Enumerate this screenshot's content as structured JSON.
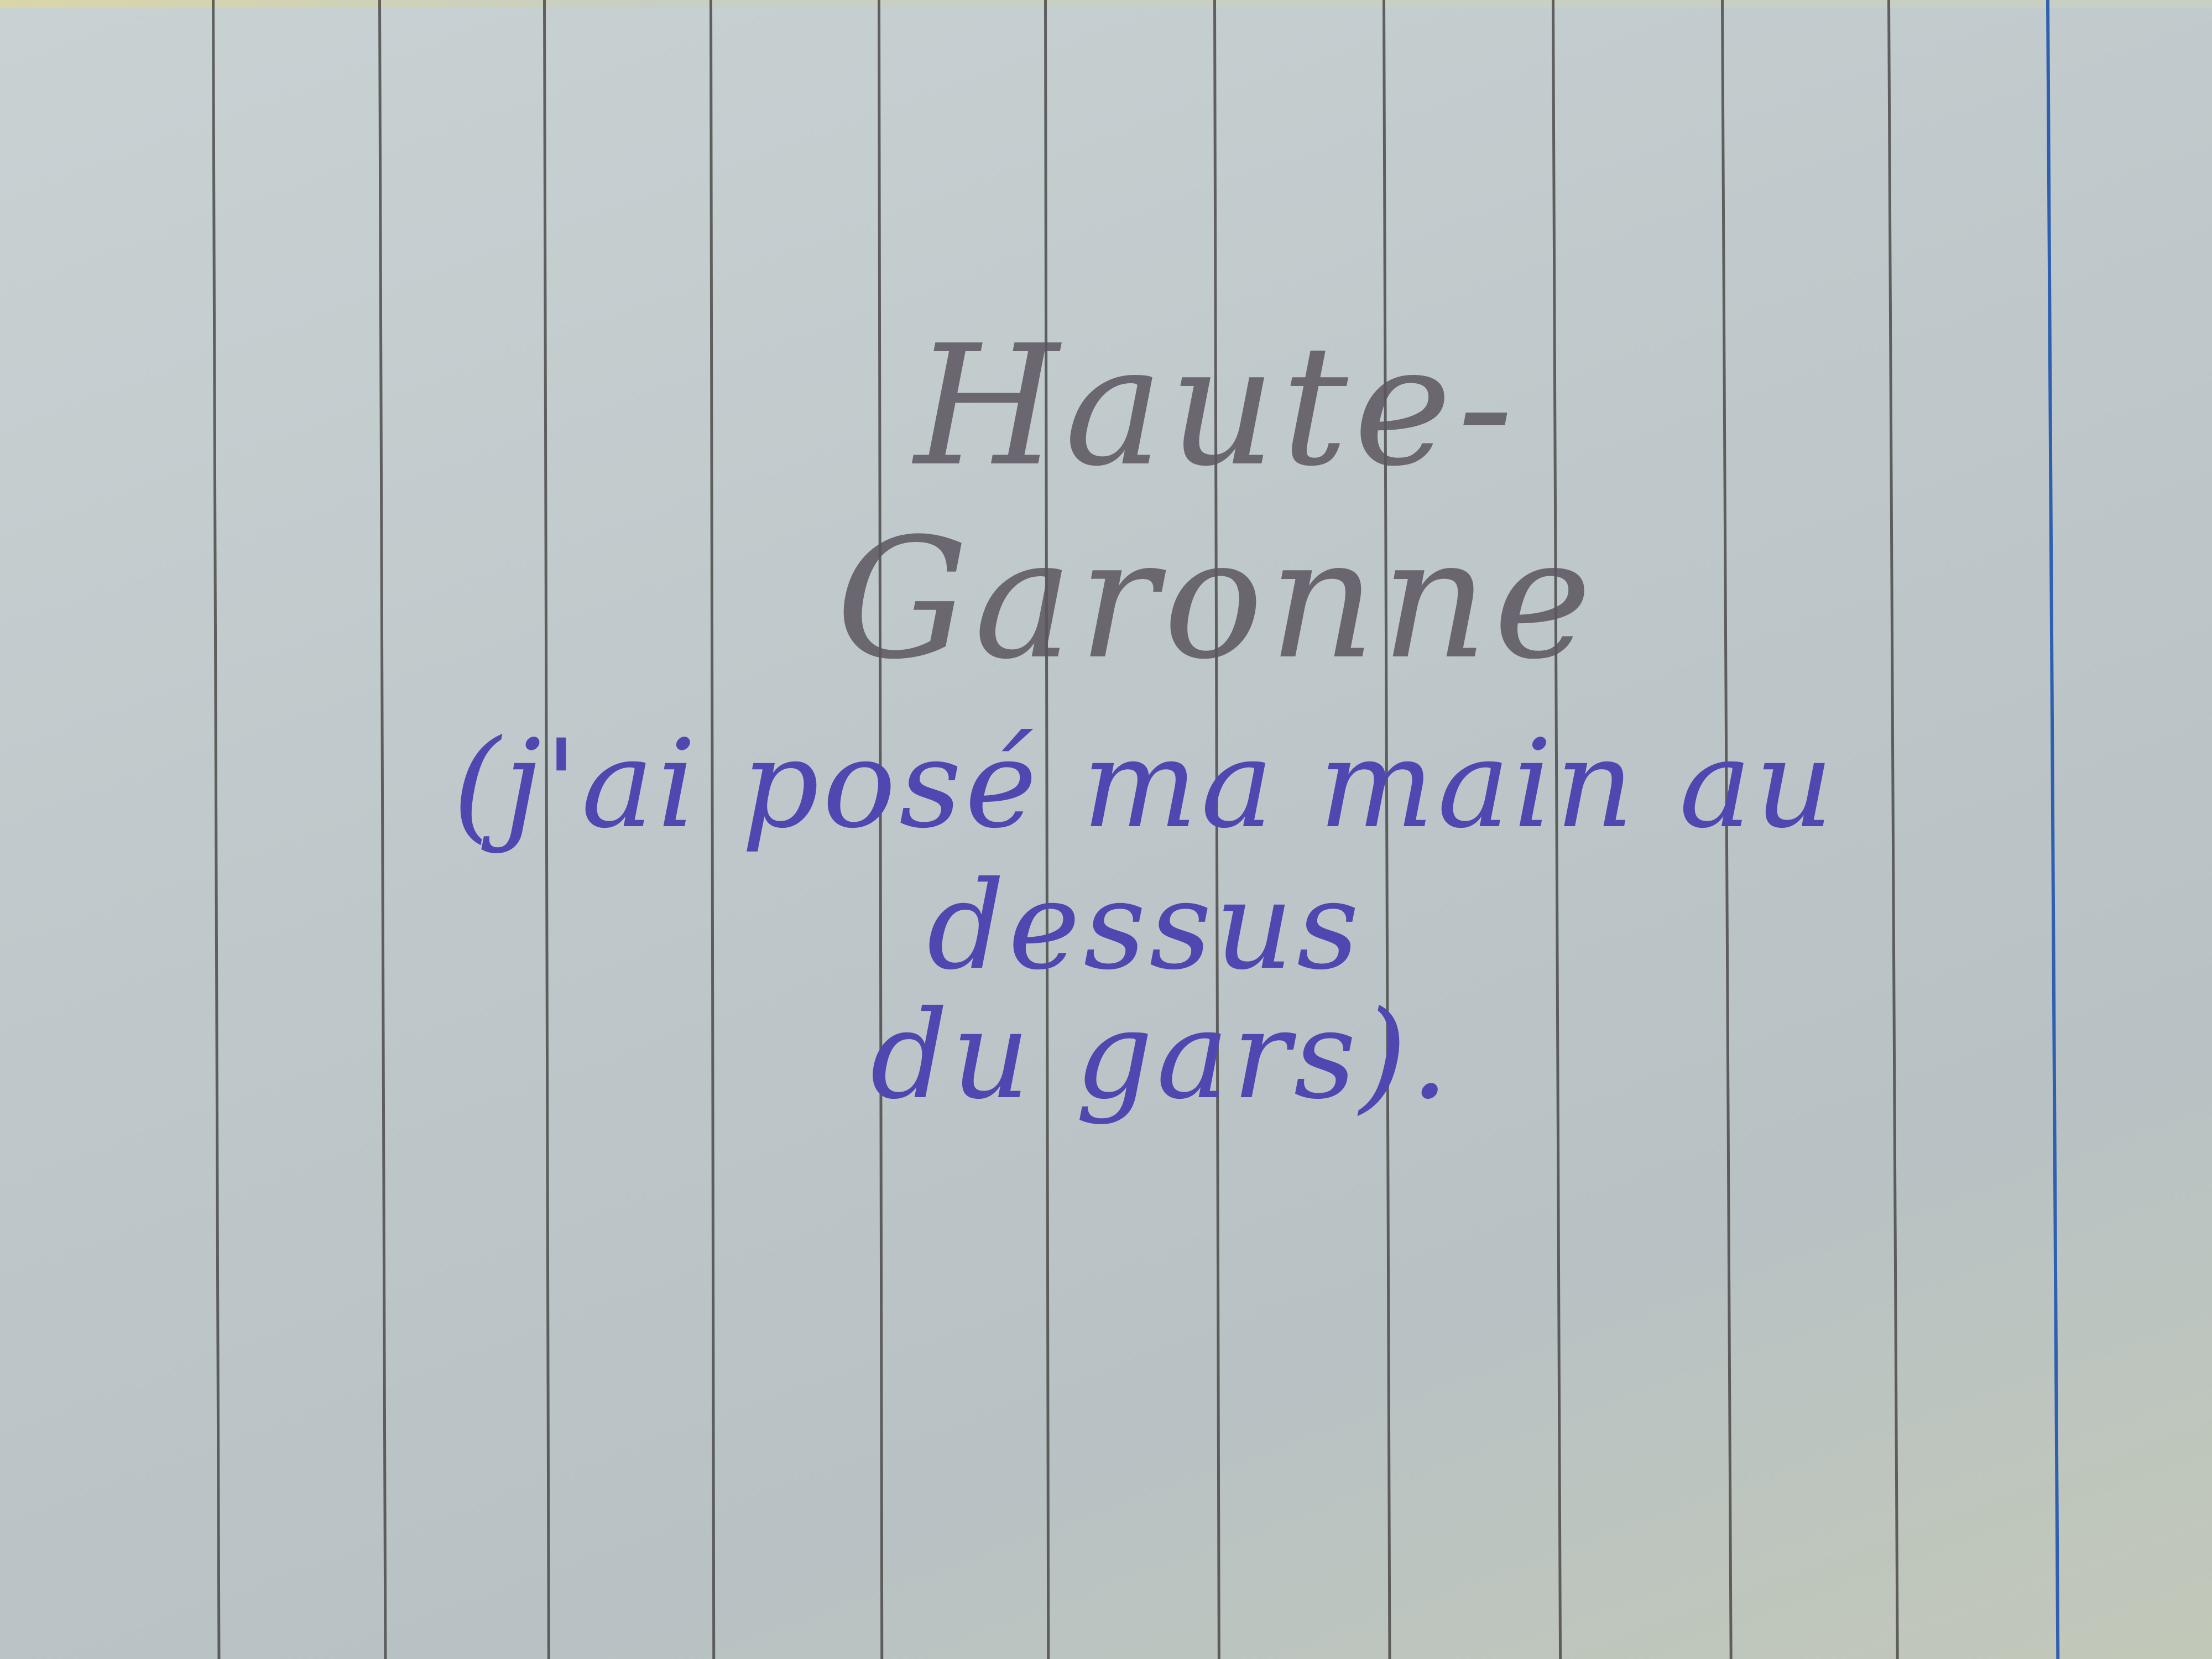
{
  "note": {
    "title": "Haute-Garonne",
    "line_1": "(j'ai posé ma main au dessus",
    "line_2": "du gars)."
  },
  "colors": {
    "paper": "#c3cccd",
    "ruling": "#3e3a3a",
    "margin_line": "#2f5fb0",
    "pencil": "#5c5660",
    "ink": "#5048b0"
  }
}
